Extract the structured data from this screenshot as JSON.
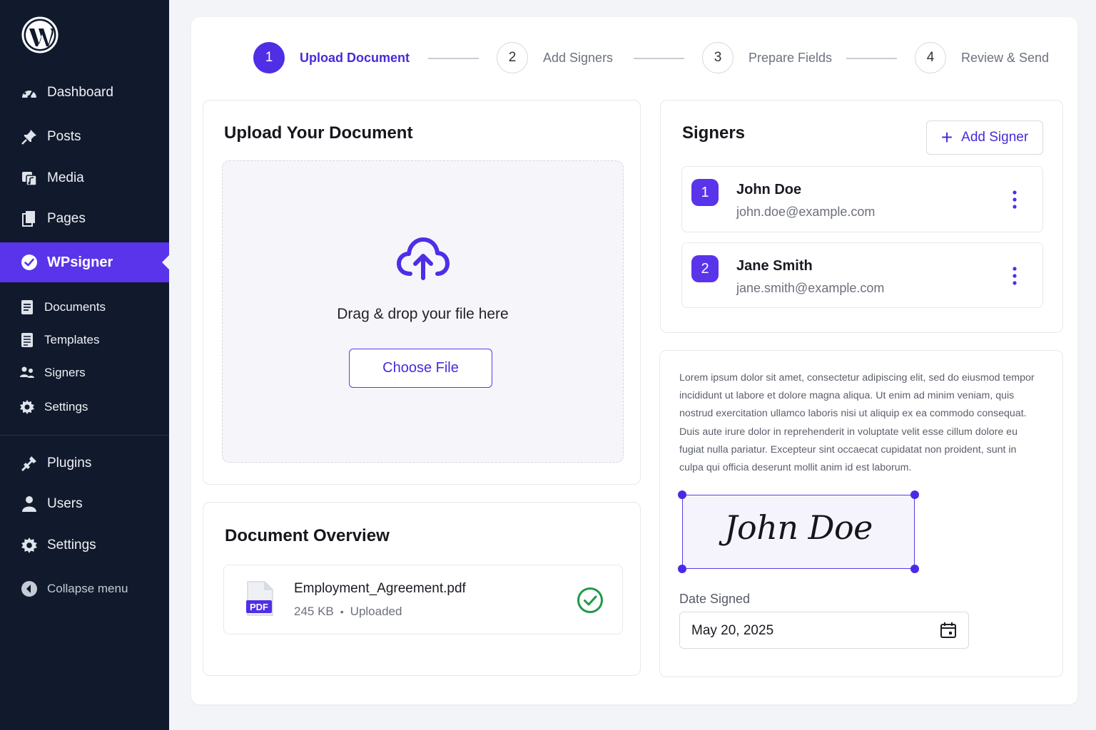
{
  "sidebar": {
    "logo_icon": "wordpress-logo",
    "items": [
      {
        "label": "Dashboard",
        "icon": "dashboard-icon"
      },
      {
        "label": "Posts",
        "icon": "pin-icon"
      },
      {
        "label": "Media",
        "icon": "media-icon"
      },
      {
        "label": "Pages",
        "icon": "pages-icon"
      },
      {
        "label": "WPsigner",
        "icon": "check-circle-icon",
        "active": true
      },
      {
        "label": "Documents",
        "icon": "document-icon"
      },
      {
        "label": "Templates",
        "icon": "template-icon"
      },
      {
        "label": "Signers",
        "icon": "users-group-icon"
      },
      {
        "label": "Settings",
        "icon": "gear-icon"
      },
      {
        "label": "Plugins",
        "icon": "plugin-icon"
      },
      {
        "label": "Users",
        "icon": "user-icon"
      },
      {
        "label": "Settings",
        "icon": "gear-icon"
      },
      {
        "label": "Collapse menu",
        "icon": "collapse-icon"
      }
    ]
  },
  "stepper": [
    {
      "num": "1",
      "label": "Upload Document",
      "active": true
    },
    {
      "num": "2",
      "label": "Add Signers"
    },
    {
      "num": "3",
      "label": "Prepare Fields"
    },
    {
      "num": "4",
      "label": "Review & Send"
    }
  ],
  "upload": {
    "title": "Upload Your Document",
    "drop_text": "Drag & drop your file here",
    "choose_label": "Choose File"
  },
  "overview": {
    "title": "Document Overview",
    "file_name": "Employment_Agreement.pdf",
    "file_size": "245 KB",
    "separator": "•",
    "file_status": "Uploaded",
    "file_badge": "PDF"
  },
  "signers": {
    "title": "Signers",
    "add_label": "Add Signer",
    "add_icon": "+",
    "list": [
      {
        "num": "1",
        "name": "John Doe",
        "email": "john.doe@example.com"
      },
      {
        "num": "2",
        "name": "Jane Smith",
        "email": "jane.smith@example.com"
      }
    ]
  },
  "preview": {
    "lorem": "Lorem ipsum dolor sit amet, consectetur adipiscing elit, sed do eiusmod tempor incididunt ut labore et dolore magna aliqua. Ut enim ad minim veniam, quis nostrud exercitation ullamco laboris nisi ut aliquip ex ea commodo consequat. Duis aute irure dolor in reprehenderit in voluptate velit esse cillum dolore eu fugiat nulla pariatur. Excepteur sint occaecat cupidatat non proident, sunt in culpa qui officia deserunt mollit anim id est laborum.",
    "signature": "John Doe",
    "date_label": "Date Signed",
    "date_value": "May 20, 2025"
  },
  "colors": {
    "accent": "#5a34ea",
    "sidebar_bg": "#111a2c",
    "success": "#1e9a4a"
  }
}
